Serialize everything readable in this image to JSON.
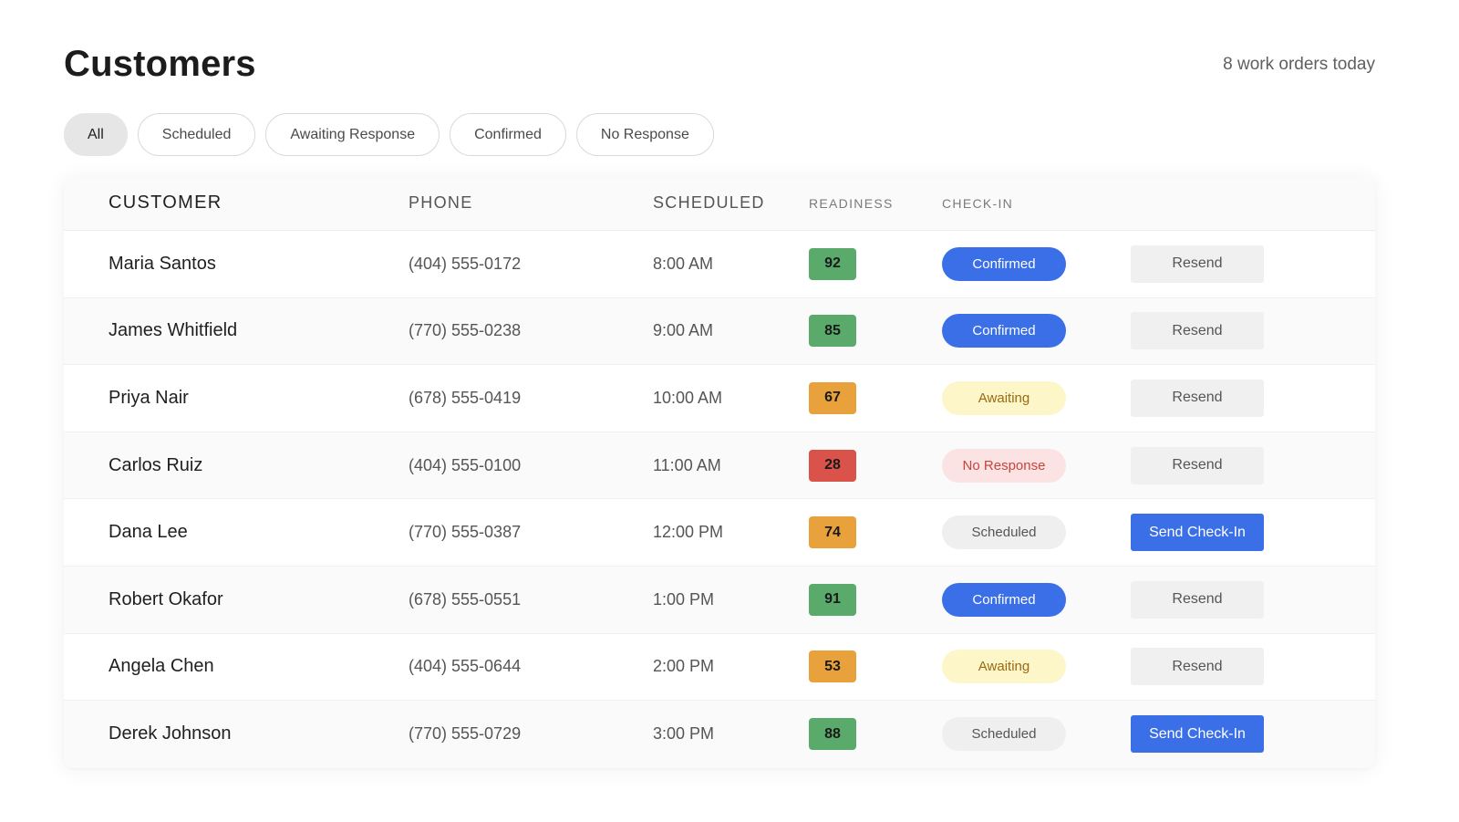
{
  "header": {
    "title": "Customers",
    "orders_count": "8 work orders today"
  },
  "filters": [
    {
      "label": "All",
      "active": true
    },
    {
      "label": "Scheduled",
      "active": false
    },
    {
      "label": "Awaiting Response",
      "active": false
    },
    {
      "label": "Confirmed",
      "active": false
    },
    {
      "label": "No Response",
      "active": false
    }
  ],
  "table": {
    "columns": [
      "CUSTOMER",
      "PHONE",
      "SCHEDULED",
      "READINESS",
      "CHECK-IN"
    ],
    "rows": [
      {
        "name": "Maria Santos",
        "phone": "(404) 555-0172",
        "time": "8:00 AM",
        "readiness": "92",
        "status": "Confirmed",
        "action": "Resend"
      },
      {
        "name": "James Whitfield",
        "phone": "(770) 555-0238",
        "time": "9:00 AM",
        "readiness": "85",
        "status": "Confirmed",
        "action": "Resend"
      },
      {
        "name": "Priya Nair",
        "phone": "(678) 555-0419",
        "time": "10:00 AM",
        "readiness": "67",
        "status": "Awaiting",
        "action": "Resend"
      },
      {
        "name": "Carlos Ruiz",
        "phone": "(404) 555-0100",
        "time": "11:00 AM",
        "readiness": "28",
        "status": "No Response",
        "action": "Resend"
      },
      {
        "name": "Dana Lee",
        "phone": "(770) 555-0387",
        "time": "12:00 PM",
        "readiness": "74",
        "status": "Scheduled",
        "action": "Send Check-In"
      },
      {
        "name": "Robert Okafor",
        "phone": "(678) 555-0551",
        "time": "1:00 PM",
        "readiness": "91",
        "status": "Confirmed",
        "action": "Resend"
      },
      {
        "name": "Angela Chen",
        "phone": "(404) 555-0644",
        "time": "2:00 PM",
        "readiness": "53",
        "status": "Awaiting",
        "action": "Resend"
      },
      {
        "name": "Derek Johnson",
        "phone": "(770) 555-0729",
        "time": "3:00 PM",
        "readiness": "88",
        "status": "Scheduled",
        "action": "Send Check-In"
      }
    ]
  },
  "colors": {
    "score_high": "#5aab6b",
    "score_mid": "#e9a23b",
    "score_low": "#d9534a",
    "confirmed_bg": "#3a6fe8",
    "confirmed_fg": "#ffffff",
    "awaiting_bg": "#fdf6c8",
    "awaiting_fg": "#9a6a12",
    "noresponse_bg": "#fbe3e3",
    "noresponse_fg": "#c8443c",
    "scheduled_bg": "#efefef",
    "scheduled_fg": "#555555",
    "primary_button_bg": "#3a6fe8",
    "primary_button_fg": "#ffffff",
    "secondary_button_bg": "#f0f0f0",
    "secondary_button_fg": "#555555"
  }
}
